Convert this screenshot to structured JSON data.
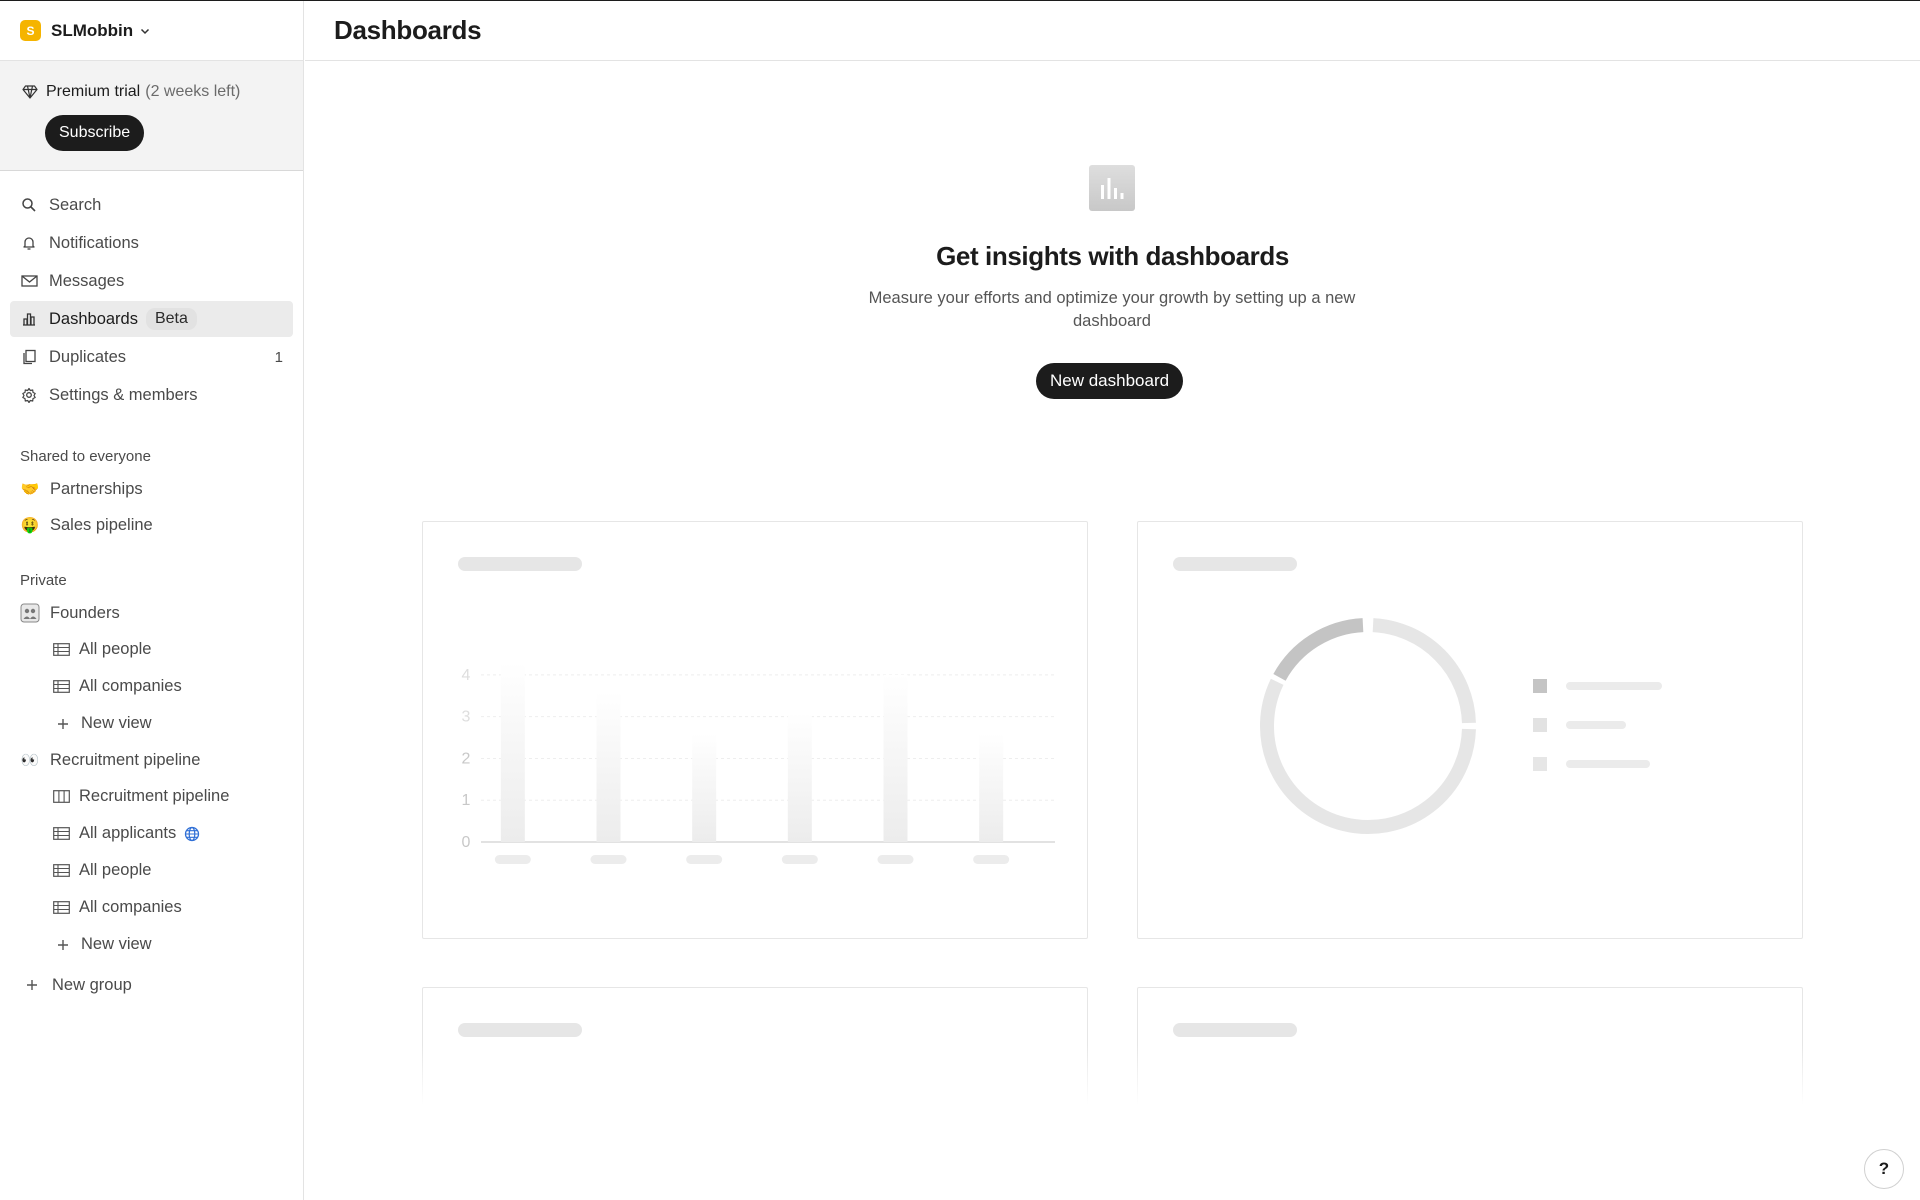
{
  "workspace": {
    "initial": "S",
    "name": "SLMobbin"
  },
  "trial": {
    "label": "Premium trial",
    "remaining": "(2 weeks left)",
    "subscribe_label": "Subscribe"
  },
  "nav": {
    "search": "Search",
    "notifications": "Notifications",
    "messages": "Messages",
    "dashboards": "Dashboards",
    "dashboards_badge": "Beta",
    "duplicates": "Duplicates",
    "duplicates_count": "1",
    "settings": "Settings & members"
  },
  "shared": {
    "label": "Shared to everyone",
    "items": [
      {
        "emoji": "🤝",
        "label": "Partnerships"
      },
      {
        "emoji": "🤑",
        "label": "Sales pipeline"
      }
    ]
  },
  "private": {
    "label": "Private",
    "founders": {
      "label": "Founders",
      "views": [
        "All people",
        "All companies"
      ],
      "new_view": "New view"
    },
    "recruitment": {
      "emoji": "👀",
      "label": "Recruitment pipeline",
      "views": [
        "Recruitment pipeline",
        "All applicants",
        "All people",
        "All companies"
      ],
      "new_view": "New view"
    },
    "new_group": "New group"
  },
  "main": {
    "title": "Dashboards",
    "empty_title": "Get insights with dashboards",
    "empty_desc": "Measure your efforts and optimize your growth by setting up a new dashboard",
    "new_dashboard_label": "New dashboard",
    "help_label": "?"
  },
  "chart_data": [
    {
      "type": "bar",
      "categories": [
        "",
        "",
        "",
        "",
        "",
        ""
      ],
      "values": [
        4.3,
        3.6,
        2.6,
        3.1,
        4.0,
        2.6
      ],
      "y_ticks": [
        "0",
        "1",
        "2",
        "3",
        "4"
      ],
      "ylim": [
        0,
        4.5
      ],
      "grid": true
    },
    {
      "type": "pie",
      "values": [
        17,
        83
      ],
      "colors": [
        "#c4c4c4",
        "#e6e6e6"
      ],
      "legend_position": "right"
    }
  ],
  "colors": {
    "accent": "#1c1c1c",
    "workspace": "#f5b400",
    "active_bg": "#ebebeb"
  }
}
